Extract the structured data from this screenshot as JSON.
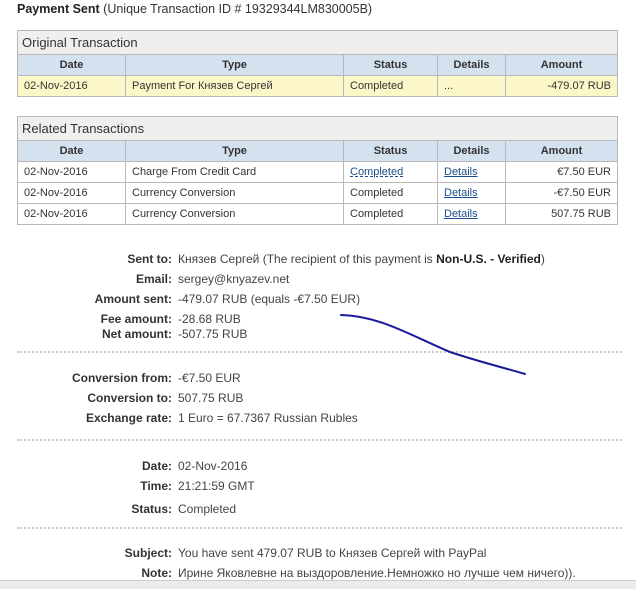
{
  "header": {
    "title": "Payment Sent",
    "subtitle": "(Unique Transaction ID # 19329344LM830005B)"
  },
  "original": {
    "caption": "Original Transaction",
    "columns": [
      "Date",
      "Type",
      "Status",
      "Details",
      "Amount"
    ],
    "rows": [
      {
        "date": "02-Nov-2016",
        "type": "Payment For Князев Сергей",
        "status": "Completed",
        "details": "...",
        "amount": "-479.07 RUB"
      }
    ]
  },
  "related": {
    "caption": "Related Transactions",
    "columns": [
      "Date",
      "Type",
      "Status",
      "Details",
      "Amount"
    ],
    "rows": [
      {
        "date": "02-Nov-2016",
        "type": "Charge From Credit Card",
        "status": "Completed",
        "details": "Details",
        "amount": "€7.50 EUR"
      },
      {
        "date": "02-Nov-2016",
        "type": "Currency Conversion",
        "status": "Completed",
        "details": "Details",
        "amount": "-€7.50 EUR"
      },
      {
        "date": "02-Nov-2016",
        "type": "Currency Conversion",
        "status": "Completed",
        "details": "Details",
        "amount": "507.75 RUB"
      }
    ]
  },
  "info": {
    "sent_to_label": "Sent to:",
    "sent_to": "Князев Сергей",
    "sent_to_note_pre": "(The recipient of this payment is ",
    "sent_to_note_bold": "Non-U.S. - Verified",
    "sent_to_note_post": ")",
    "email_label": "Email:",
    "email": "sergey@knyazev.net",
    "amount_sent_label": "Amount sent:",
    "amount_sent": "-479.07 RUB (equals -€7.50 EUR)",
    "fee_label": "Fee amount:",
    "fee": "-28.68 RUB",
    "net_label": "Net amount:",
    "net": "-507.75 RUB",
    "conv_from_label": "Conversion from:",
    "conv_from": "-€7.50 EUR",
    "conv_to_label": "Conversion to:",
    "conv_to": "507.75 RUB",
    "rate_label": "Exchange rate:",
    "rate": "1 Euro = 67.7367 Russian Rubles",
    "date_label": "Date:",
    "date": "02-Nov-2016",
    "time_label": "Time:",
    "time": "21:21:59 GMT",
    "status_label": "Status:",
    "status": "Completed",
    "subject_label": "Subject:",
    "subject": "You have sent 479.07 RUB to Князев Сергей with PayPal",
    "note_label": "Note:",
    "note": "Ирине Яковлевне на выздоровление.Немножко но лучше чем ничего))."
  }
}
